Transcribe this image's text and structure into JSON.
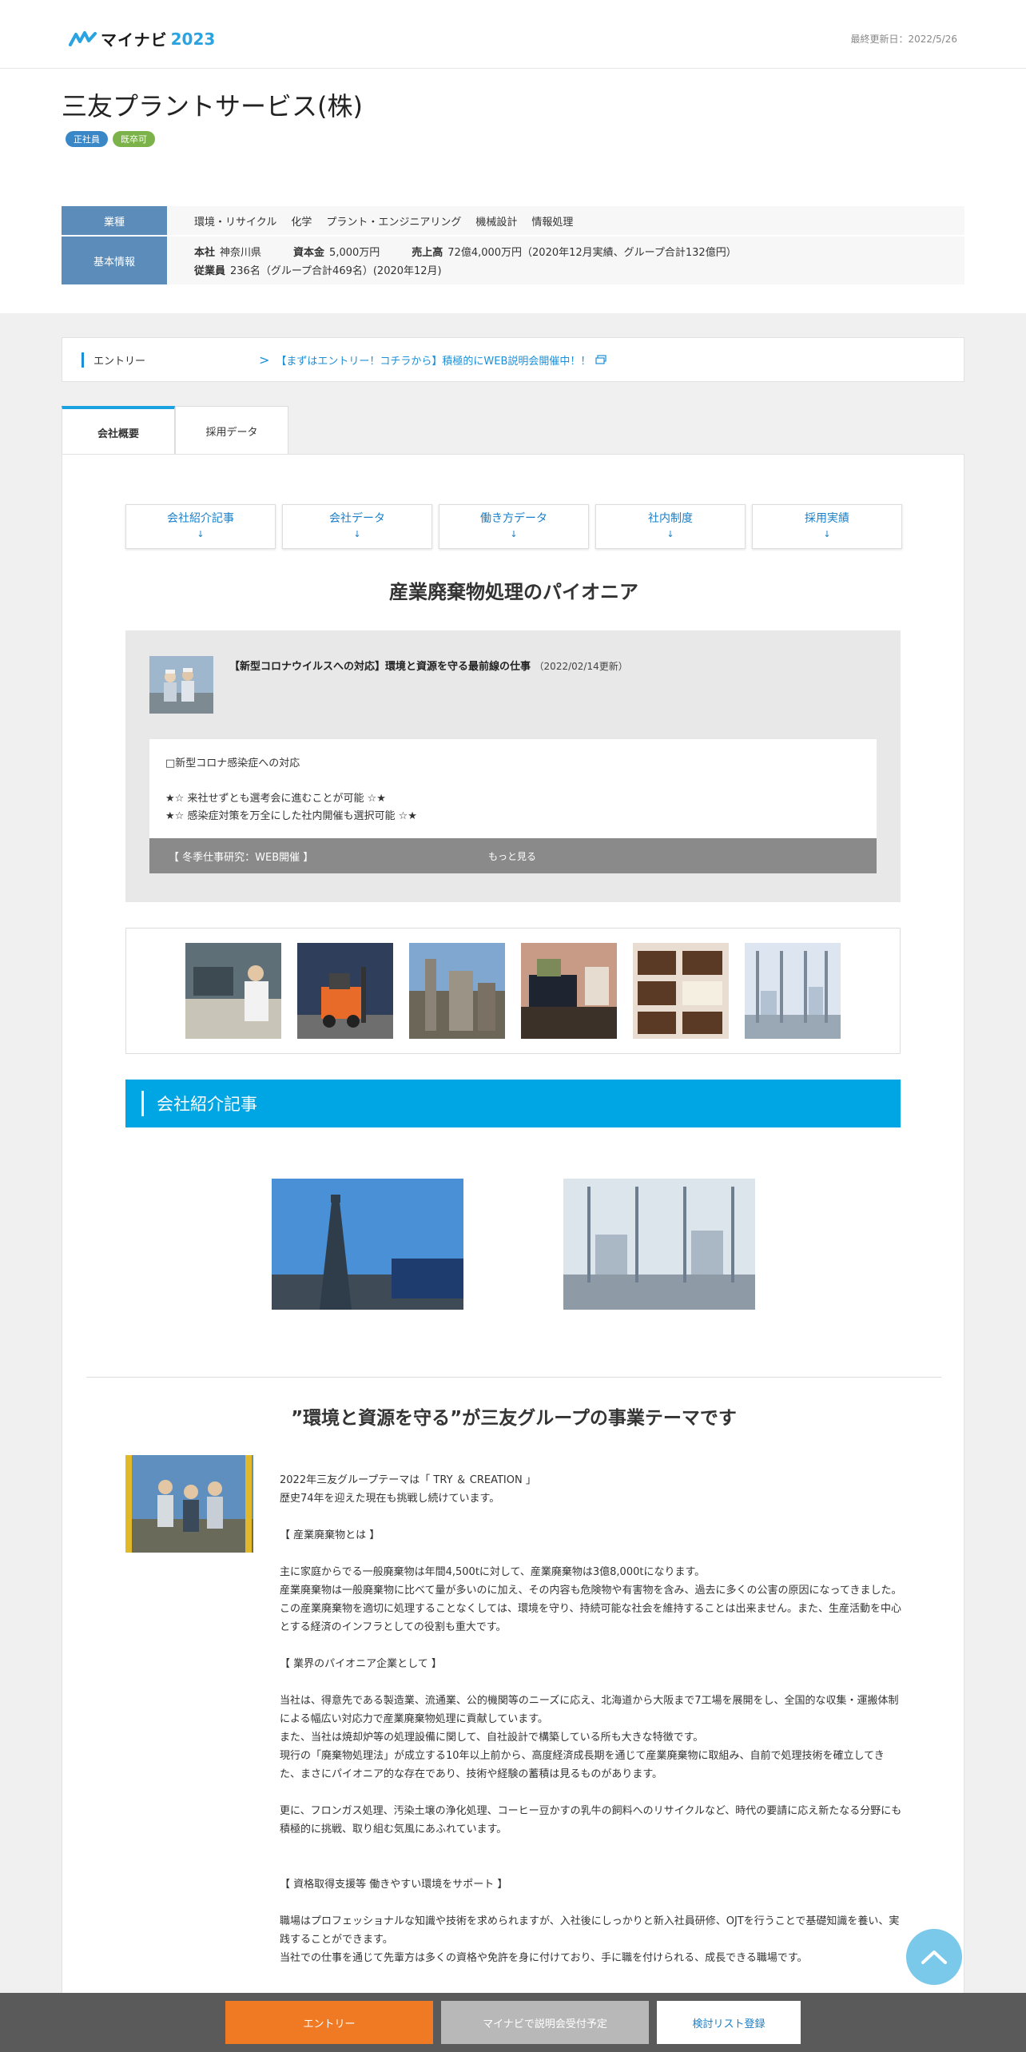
{
  "header": {
    "logo_text": "マイナビ",
    "logo_year": "2023",
    "updated": "最終更新日：2022/5/26"
  },
  "company": {
    "name": "三友プラントサービス(株)",
    "badges": [
      "正社員",
      "既卒可"
    ]
  },
  "info": {
    "industry_label": "業種",
    "industries": [
      "環境・リサイクル",
      "化学",
      "プラント・エンジニアリング",
      "機械設計",
      "情報処理"
    ],
    "basic_label": "基本情報",
    "hq_key": "本社",
    "hq_val": "神奈川県",
    "capital_key": "資本金",
    "capital_val": "5,000万円",
    "sales_key": "売上高",
    "sales_val": "72億4,000万円（2020年12月実績、グループ合計132億円）",
    "employees_key": "従業員",
    "employees_val": "236名（グループ合計469名）(2020年12月)"
  },
  "entry": {
    "label": "エントリー",
    "link": "【まずはエントリー！コチラから】積極的にWEB説明会開催中！！"
  },
  "tabs": [
    "会社概要",
    "採用データ"
  ],
  "subnav": [
    {
      "label": "会社紹介記事",
      "arrow": "↓"
    },
    {
      "label": "会社データ",
      "arrow": "↓"
    },
    {
      "label": "働き方データ",
      "arrow": "↓"
    },
    {
      "label": "社内制度",
      "arrow": "↓"
    },
    {
      "label": "採用実績",
      "arrow": "↓"
    }
  ],
  "tagline": "産業廃棄物処理のパイオニア",
  "news": {
    "title": "【新型コロナウイルスへの対応】環境と資源を守る最前線の仕事",
    "date": "（2022/02/14更新）",
    "lines": [
      "□新型コロナ感染症への対応",
      "",
      "★☆ 来社せずとも選考会に進むことが可能 ☆★",
      "★☆ 感染症対策を万全にした社内開催も選択可能 ☆★"
    ],
    "more_left": "【 冬季仕事研究：WEB開催 】",
    "more": "もっと見る"
  },
  "section_title": "会社紹介記事",
  "theme": "”環境と資源を守る”が三友グループの事業テーマです",
  "body": [
    "2022年三友グループテーマは「 TRY ＆ CREATION 」",
    "歴史74年を迎えた現在も挑戦し続けています。",
    "",
    "【 産業廃棄物とは 】",
    "",
    "主に家庭からでる一般廃棄物は年間4,500tに対して、産業廃棄物は3億8,000tになります。",
    "産業廃棄物は一般廃棄物に比べて量が多いのに加え、その内容も危険物や有害物を含み、過去に多くの公害の原因になってきました。",
    "この産業廃棄物を適切に処理することなくしては、環境を守り、持続可能な社会を維持することは出来ません。また、生産活動を中心とする経済のインフラとしての役割も重大です。",
    "",
    "【 業界のパイオニア企業として 】",
    "",
    "当社は、得意先である製造業、流通業、公的機関等のニーズに応え、北海道から大阪まで7工場を展開をし、全国的な収集・運搬体制による幅広い対応力で産業廃棄物処理に貢献しています。",
    "また、当社は焼却炉等の処理設備に関して、自社設計で構築している所も大きな特徴です。",
    "現行の「廃棄物処理法」が成立する10年以上前から、高度経済成長期を通じて産業廃棄物に取組み、自前で処理技術を確立してきた、まさにパイオニア的な存在であり、技術や経験の蓄積は見るものがあります。",
    "",
    "更に、フロンガス処理、汚染土壌の浄化処理、コーヒー豆かすの乳牛の飼料へのリサイクルなど、時代の要請に応え新たなる分野にも積極的に挑戦、取り組む気風にあふれています。",
    "",
    "",
    "【 資格取得支援等 働きやすい環境をサポート 】",
    "",
    "職場はプロフェッショナルな知識や技術を求められますが、入社後にしっかりと新入社員研修、OJTを行うことで基礎知識を養い、実践することができます。",
    "当社での仕事を通じて先輩方は多くの資格や免許を身に付けており、手に職を付けられる、成長できる職場です。"
  ],
  "footer": {
    "entry": "エントリー",
    "seminar": "マイナビで説明会受付予定",
    "bookmark": "検討リスト登録"
  },
  "colors": {
    "accent": "#00a6e3",
    "label_bg": "#5b8cba",
    "entry_btn": "#f07a24"
  }
}
